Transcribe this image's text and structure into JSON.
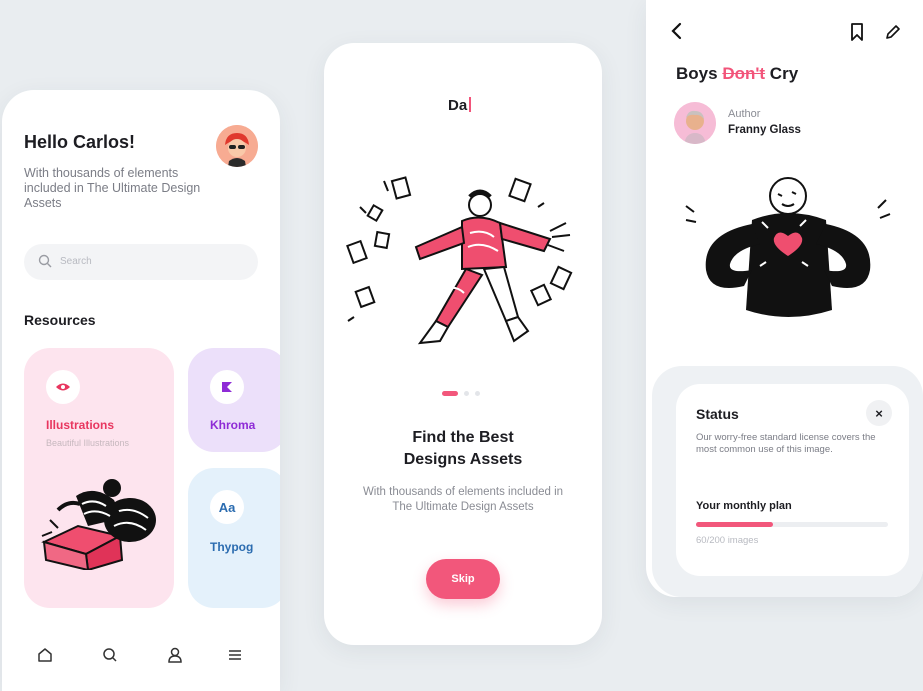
{
  "colors": {
    "accent": "#f2577b",
    "background": "#e9edf0"
  },
  "screen1": {
    "greeting": "Hello Carlos!",
    "subtitle": "With thousands of elements included in The Ultimate Design Assets",
    "search_placeholder": "Search",
    "section_title": "Resources",
    "cards": [
      {
        "title": "Illustrations",
        "subtitle": "Beautiful Illustrations",
        "icon": "eye-icon",
        "color": "#fde4ee"
      },
      {
        "title": "Khroma",
        "icon": "khroma-logo-icon",
        "color": "#ece0fa"
      },
      {
        "title": "Thypog",
        "icon_text": "Aa",
        "color": "#e4f1fb"
      }
    ],
    "nav": [
      "home-icon",
      "search-icon",
      "profile-icon",
      "menu-icon"
    ]
  },
  "screen2": {
    "logo": "Da",
    "heading_line1": "Find the Best",
    "heading_line2": "Designs Assets",
    "subtitle": "With thousands of elements included in The Ultimate Design Assets",
    "skip_label": "Skip",
    "page_dots": {
      "total": 3,
      "active": 1
    }
  },
  "screen3": {
    "title_before": "Boys",
    "title_strike": "Don't",
    "title_after": "Cry",
    "author_label": "Author",
    "author_name": "Franny Glass",
    "status": {
      "title": "Status",
      "close_label": "×",
      "text": "Our worry-free standard license covers the most common use of this image.",
      "plan_label": "Your monthly plan",
      "usage_text": "60/200 images",
      "usage_fraction": 0.4
    }
  }
}
